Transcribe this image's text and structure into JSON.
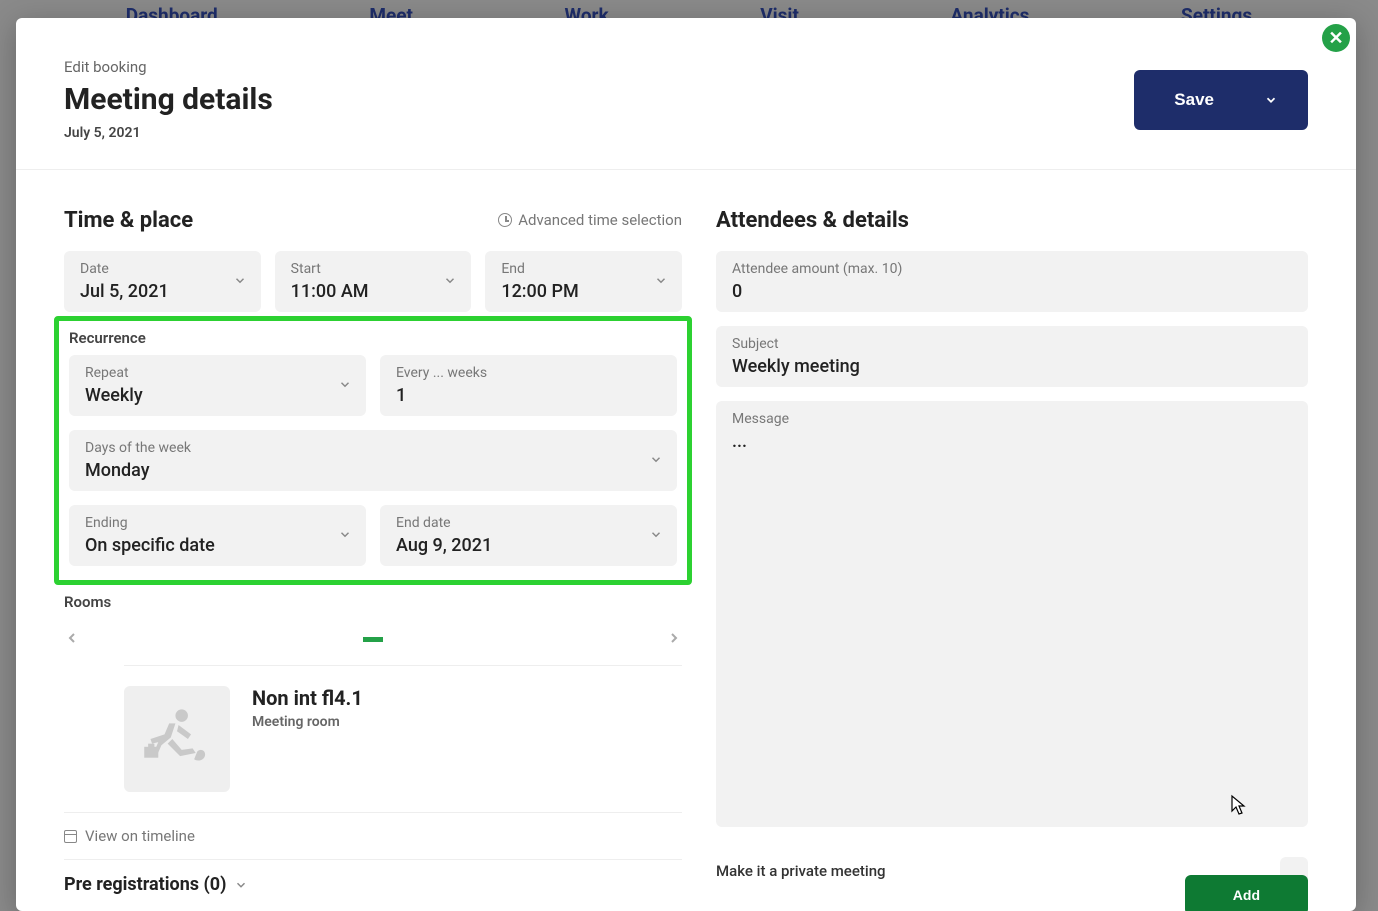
{
  "topnav": [
    "Dashboard",
    "Meet",
    "Work",
    "Visit",
    "Analytics",
    "Settings"
  ],
  "header": {
    "eyebrow": "Edit booking",
    "title": "Meeting details",
    "date": "July 5, 2021",
    "save_label": "Save"
  },
  "time_place": {
    "title": "Time & place",
    "advanced_label": "Advanced time selection",
    "date": {
      "label": "Date",
      "value": "Jul 5, 2021"
    },
    "start": {
      "label": "Start",
      "value": "11:00 AM"
    },
    "end": {
      "label": "End",
      "value": "12:00 PM"
    }
  },
  "recurrence": {
    "title": "Recurrence",
    "repeat": {
      "label": "Repeat",
      "value": "Weekly"
    },
    "every": {
      "label": "Every ... weeks",
      "value": "1"
    },
    "days": {
      "label": "Days of the week",
      "value": "Monday"
    },
    "ending": {
      "label": "Ending",
      "value": "On specific date"
    },
    "end_date": {
      "label": "End date",
      "value": "Aug 9, 2021"
    }
  },
  "rooms": {
    "title": "Rooms",
    "selected": {
      "name": "Non int fl4.1",
      "type": "Meeting room"
    },
    "timeline_label": "View on timeline"
  },
  "prereg": {
    "title": "Pre registrations (0)"
  },
  "attendees": {
    "title": "Attendees & details",
    "amount": {
      "label": "Attendee amount (max. 10)",
      "value": "0"
    },
    "subject": {
      "label": "Subject",
      "value": "Weekly meeting"
    },
    "message": {
      "label": "Message",
      "value": "..."
    },
    "private_label": "Make it a private meeting",
    "add_label": "Add"
  }
}
